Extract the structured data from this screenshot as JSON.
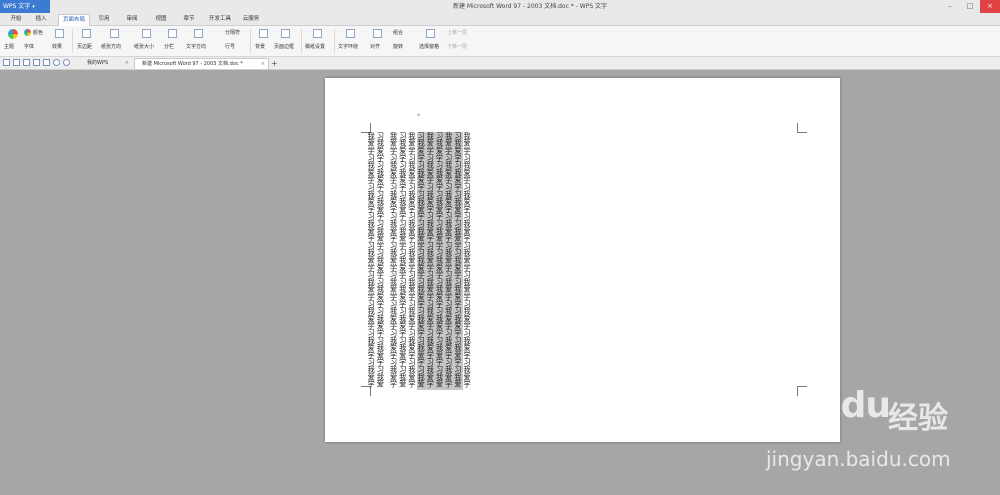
{
  "app": {
    "name": "WPS 文字",
    "title": "新建 Microsoft Word 97 - 2003 文档.doc * - WPS 文字"
  },
  "menu_tabs": [
    "开始",
    "插入",
    "页面布局",
    "引用",
    "审阅",
    "视图",
    "章节",
    "开发工具",
    "云服务"
  ],
  "active_menu_tab": "页面布局",
  "ribbon": {
    "theme": "主题",
    "colors": "颜色",
    "fonts": "字体",
    "effects": "效果",
    "margins": "页边距",
    "orientation": "纸张方向",
    "size": "纸张大小",
    "columns": "分栏",
    "text_direction": "文字方向",
    "breaks": "分隔符",
    "line_numbers": "行号",
    "background": "背景",
    "page_border": "页面边框",
    "manuscript": "稿纸设置",
    "wrap": "文字环绕",
    "align": "对齐",
    "group": "组合",
    "rotate": "旋转",
    "selection_pane": "选择窗格",
    "bring_forward": "上移一层",
    "send_backward": "下移一层"
  },
  "doc_tabs": [
    {
      "label": "我的WPS"
    },
    {
      "label": "新建 Microsoft Word 97 - 2003 文档.doc *"
    }
  ],
  "document": {
    "columns": [
      {
        "text": "我爱学习我爱学习我爱学习我爱学习我爱学习我爱学习我爱学习我爱学习我爱学习我爱学习",
        "selected": false
      },
      {
        "text": "习我爱学习我爱学习我爱学习我爱学习我爱学习我爱学习我爱学习我爱学习我爱学习我爱学习我爱学习我爱学习",
        "selected": true
      },
      {
        "text": "我爱学习我爱学习我爱学习我爱学习我爱学习我爱学习我爱学习我爱学习我爱学习我爱学习我爱学习我爱学习",
        "selected": true
      },
      {
        "text": "习我爱学习我爱学习我爱学习我爱学习我爱学习我爱学习我爱学习我爱学习我爱学习我爱学习我爱学习我爱学习",
        "selected": true
      },
      {
        "text": "我爱学习我爱学习我爱学习我爱学习我爱学习我爱学习我爱学习我爱学习我爱学习我爱学习我爱学习我爱学习",
        "selected": true
      },
      {
        "text": "习我爱学习我爱学习我爱学习我爱学习我爱学习我爱学习我爱学习我爱学习我爱学习我爱学习我爱学习我爱学习",
        "selected": true
      },
      {
        "text": "我爱学习我爱学习我爱学习我爱学习我爱学习我爱学习我爱学习我爱学习我爱学习我爱学习我爱学习我爱学习",
        "selected": false
      },
      {
        "text": "习我爱学习我爱学习我爱学习我爱学习我爱学习我爱学习我爱学习我爱学习我爱学习我爱学习我爱学习我爱学习",
        "selected": false
      },
      {
        "text": "我爱学习我爱学习我爱学习我爱学习我爱学习我爱学习我爱学习我爱学习我爱学习我爱学习我爱学习我爱学习",
        "selected": false
      },
      {
        "text": "",
        "selected": false
      },
      {
        "text": "习我爱学习我爱学习我爱学习我爱学习我爱学习我爱学习我爱学习我爱学习我爱学习我爱学习我爱学习我爱学习",
        "selected": false
      },
      {
        "text": "我爱学习我爱学习我爱学习我爱学习我爱学习我爱学习我爱学习我爱学习我爱学习我爱学习我爱学习我爱学习",
        "selected": false
      }
    ]
  },
  "watermark": {
    "logo": "Bai du",
    "cn": "经验",
    "url": "jingyan.baidu.com"
  },
  "colors": {
    "accent": "#3d7bd3",
    "selection": "#c7c7c7",
    "workspace": "#a6a6a6"
  }
}
